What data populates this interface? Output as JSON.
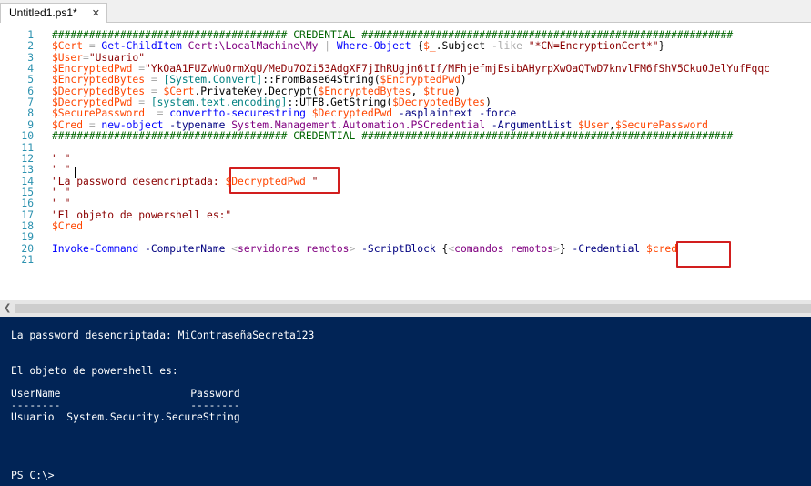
{
  "tab": {
    "title": "Untitled1.ps1*",
    "close_glyph": "✕"
  },
  "editor": {
    "lines": [
      {
        "n": "1",
        "segs": [
          {
            "c": "cm",
            "t": "###################################### CREDENTIAL ############################################################"
          }
        ]
      },
      {
        "n": "2",
        "segs": [
          {
            "c": "vr",
            "t": "$Cert"
          },
          {
            "c": "op",
            "t": " = "
          },
          {
            "c": "cmd",
            "t": "Get-ChildItem"
          },
          {
            "c": "nm",
            "t": " Cert:\\LocalMachine\\My"
          },
          {
            "c": "op",
            "t": " | "
          },
          {
            "c": "cmd",
            "t": "Where-Object"
          },
          {
            "c": "mem",
            "t": " {"
          },
          {
            "c": "vr",
            "t": "$_"
          },
          {
            "c": "mem",
            "t": ".Subject "
          },
          {
            "c": "op",
            "t": "-like"
          },
          {
            "c": "st",
            "t": " \"*CN=EncryptionCert*\""
          },
          {
            "c": "mem",
            "t": "}"
          }
        ]
      },
      {
        "n": "3",
        "segs": [
          {
            "c": "vr",
            "t": "$User"
          },
          {
            "c": "op",
            "t": "="
          },
          {
            "c": "st",
            "t": "\"Usuario\""
          }
        ]
      },
      {
        "n": "4",
        "segs": [
          {
            "c": "vr",
            "t": "$EncryptedPwd"
          },
          {
            "c": "op",
            "t": " ="
          },
          {
            "c": "st",
            "t": "\"YkOaA1FUZvWuOrmXqU/MeDu7OZi53AdgXF7jIhRUgjn6tIf/MFhjefmjEsibAHyrpXwOaQTwD7knvlFM6fShV5Cku0JelYufFqqc"
          }
        ]
      },
      {
        "n": "5",
        "segs": [
          {
            "c": "vr",
            "t": "$EncryptedBytes"
          },
          {
            "c": "op",
            "t": " = "
          },
          {
            "c": "ty",
            "t": "[System.Convert]"
          },
          {
            "c": "mem",
            "t": "::FromBase64String("
          },
          {
            "c": "vr",
            "t": "$EncryptedPwd"
          },
          {
            "c": "mem",
            "t": ")"
          }
        ]
      },
      {
        "n": "6",
        "segs": [
          {
            "c": "vr",
            "t": "$DecryptedBytes"
          },
          {
            "c": "op",
            "t": " = "
          },
          {
            "c": "vr",
            "t": "$Cert"
          },
          {
            "c": "mem",
            "t": ".PrivateKey.Decrypt("
          },
          {
            "c": "vr",
            "t": "$EncryptedBytes"
          },
          {
            "c": "mem",
            "t": ", "
          },
          {
            "c": "vr",
            "t": "$true"
          },
          {
            "c": "mem",
            "t": ")"
          }
        ]
      },
      {
        "n": "7",
        "segs": [
          {
            "c": "vr",
            "t": "$DecryptedPwd"
          },
          {
            "c": "op",
            "t": " = "
          },
          {
            "c": "ty",
            "t": "[system.text.encoding]"
          },
          {
            "c": "mem",
            "t": "::UTF8.GetString("
          },
          {
            "c": "vr",
            "t": "$DecryptedBytes"
          },
          {
            "c": "mem",
            "t": ")"
          }
        ]
      },
      {
        "n": "8",
        "segs": [
          {
            "c": "vr",
            "t": "$SecurePassword"
          },
          {
            "c": "op",
            "t": "  = "
          },
          {
            "c": "cmd",
            "t": "convertto-securestring"
          },
          {
            "c": "vr",
            "t": " $DecryptedPwd"
          },
          {
            "c": "pm",
            "t": " -asplaintext -force"
          }
        ]
      },
      {
        "n": "9",
        "segs": [
          {
            "c": "vr",
            "t": "$Cred"
          },
          {
            "c": "op",
            "t": " = "
          },
          {
            "c": "cmd",
            "t": "new-object"
          },
          {
            "c": "pm",
            "t": " -typename"
          },
          {
            "c": "nm",
            "t": " System.Management.Automation.PSCredential"
          },
          {
            "c": "pm",
            "t": " -ArgumentList"
          },
          {
            "c": "vr",
            "t": " $User"
          },
          {
            "c": "mem",
            "t": ","
          },
          {
            "c": "vr",
            "t": "$SecurePassword"
          }
        ]
      },
      {
        "n": "10",
        "segs": [
          {
            "c": "cm",
            "t": "###################################### CREDENTIAL ############################################################"
          }
        ]
      },
      {
        "n": "11",
        "segs": []
      },
      {
        "n": "12",
        "segs": [
          {
            "c": "st",
            "t": "\" \""
          }
        ]
      },
      {
        "n": "13",
        "segs": [
          {
            "c": "st",
            "t": "\" \""
          }
        ]
      },
      {
        "n": "14",
        "segs": [
          {
            "c": "st",
            "t": "\"La password desencriptada: "
          },
          {
            "c": "vr",
            "t": "$DecryptedPwd"
          },
          {
            "c": "st",
            "t": " \""
          }
        ]
      },
      {
        "n": "15",
        "segs": [
          {
            "c": "st",
            "t": "\" \""
          }
        ]
      },
      {
        "n": "16",
        "segs": [
          {
            "c": "st",
            "t": "\" \""
          }
        ]
      },
      {
        "n": "17",
        "segs": [
          {
            "c": "st",
            "t": "\"El objeto de powershell es:\""
          }
        ]
      },
      {
        "n": "18",
        "segs": [
          {
            "c": "vr",
            "t": "$Cred"
          }
        ]
      },
      {
        "n": "19",
        "segs": []
      },
      {
        "n": "20",
        "segs": [
          {
            "c": "cmd",
            "t": "Invoke-Command"
          },
          {
            "c": "pm",
            "t": " -ComputerName"
          },
          {
            "c": "op",
            "t": " <"
          },
          {
            "c": "nm",
            "t": "servidores remotos"
          },
          {
            "c": "op",
            "t": ">"
          },
          {
            "c": "pm",
            "t": " -ScriptBlock"
          },
          {
            "c": "mem",
            "t": " {"
          },
          {
            "c": "op",
            "t": "<"
          },
          {
            "c": "nm",
            "t": "comandos remotos"
          },
          {
            "c": "op",
            "t": ">"
          },
          {
            "c": "mem",
            "t": "}"
          },
          {
            "c": "pm",
            "t": " -Credential "
          },
          {
            "c": "vr",
            "t": "$cred"
          }
        ]
      },
      {
        "n": "21",
        "segs": []
      }
    ]
  },
  "console": {
    "lines": [
      "La password desencriptada: MiContraseñaSecreta123",
      "",
      "",
      "El objeto de powershell es:",
      "",
      "UserName                     Password",
      "--------                     --------",
      "Usuario  System.Security.SecureString",
      "",
      "",
      "",
      "",
      "PS C:\\>"
    ]
  },
  "colors": {
    "console_bg": "#012456",
    "highlight_border": "#d21e1e",
    "line_number": "#2b91af",
    "comment": "#006400",
    "variable": "#ff4500",
    "string": "#8b0000",
    "command": "#0000ff"
  },
  "icons": {
    "scroll_left": "scroll-left-arrow-icon",
    "tab_close": "close-icon"
  }
}
